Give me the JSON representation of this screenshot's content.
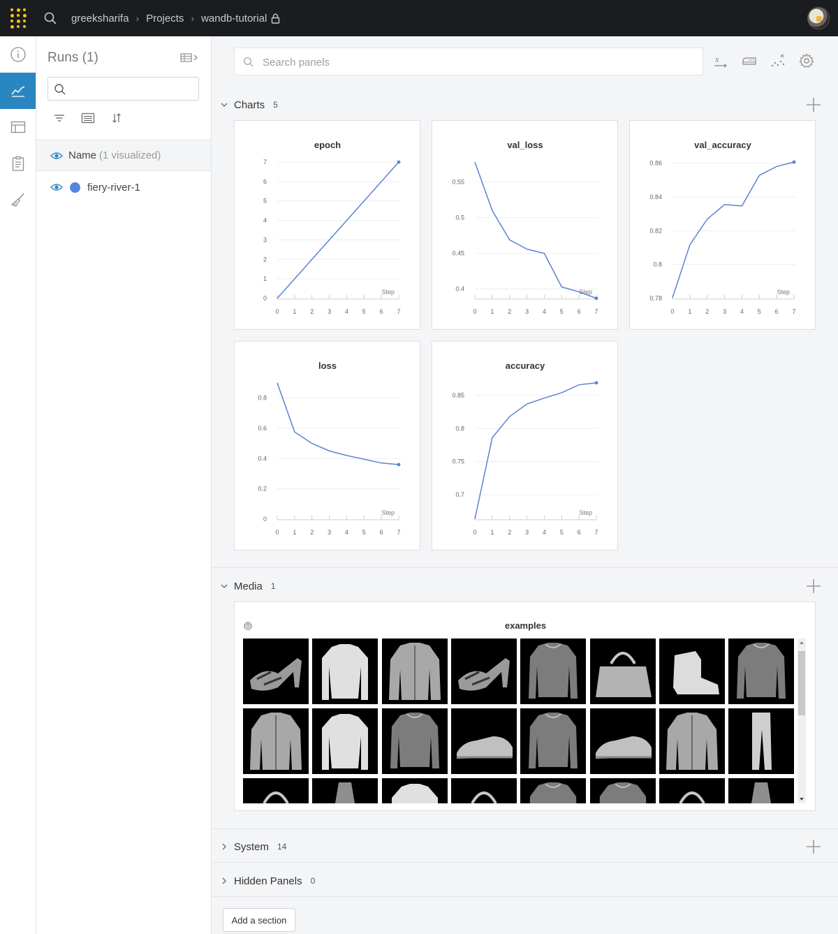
{
  "breadcrumb": {
    "user": "greeksharifa",
    "projects": "Projects",
    "project": "wandb-tutorial"
  },
  "runs": {
    "title": "Runs (1)",
    "header_label": "Name",
    "header_sub": "(1 visualized)",
    "items": [
      {
        "name": "fiery-river-1",
        "color": "#5387dd"
      }
    ]
  },
  "search": {
    "placeholder": "Search panels"
  },
  "sections": {
    "charts": {
      "name": "Charts",
      "count": "5"
    },
    "media": {
      "name": "Media",
      "count": "1"
    },
    "system": {
      "name": "System",
      "count": "14"
    },
    "hidden": {
      "name": "Hidden Panels",
      "count": "0"
    }
  },
  "media": {
    "title": "examples",
    "images": [
      "sandal",
      "shirt",
      "coat",
      "sandal",
      "pullover",
      "bag",
      "ankle-boot",
      "pullover",
      "coat",
      "shirt",
      "pullover",
      "sneaker",
      "pullover",
      "sneaker",
      "coat",
      "trouser",
      "bag",
      "dress",
      "shirt",
      "bag",
      "pullover",
      "pullover",
      "bag",
      "dress"
    ]
  },
  "add_section_label": "Add a section",
  "accent_color": "#2a86c0",
  "line_color": "#5a82d4",
  "chart_data": [
    {
      "type": "line",
      "title": "epoch",
      "xlabel": "Step",
      "ylabel": "",
      "x": [
        0,
        1,
        2,
        3,
        4,
        5,
        6,
        7
      ],
      "y": [
        0,
        1,
        2,
        3,
        4,
        5,
        6,
        7
      ],
      "xlim": [
        0,
        7
      ],
      "ylim": [
        0,
        7
      ],
      "yticks": [
        "0",
        "1",
        "2",
        "3",
        "4",
        "5",
        "6",
        "7"
      ]
    },
    {
      "type": "line",
      "title": "val_loss",
      "xlabel": "Step",
      "ylabel": "",
      "x": [
        0,
        1,
        2,
        3,
        4,
        5,
        6,
        7
      ],
      "y": [
        0.578,
        0.51,
        0.469,
        0.456,
        0.45,
        0.403,
        0.396,
        0.387
      ],
      "xlim": [
        0,
        7
      ],
      "ylim": [
        0.387,
        0.578
      ],
      "yticks": [
        "0.4",
        "0.45",
        "0.5",
        "0.55"
      ]
    },
    {
      "type": "line",
      "title": "val_accuracy",
      "xlabel": "Step",
      "ylabel": "",
      "x": [
        0,
        1,
        2,
        3,
        4,
        5,
        6,
        7
      ],
      "y": [
        0.7803,
        0.8117,
        0.8269,
        0.8355,
        0.8347,
        0.8528,
        0.8581,
        0.8607
      ],
      "xlim": [
        0,
        7
      ],
      "ylim": [
        0.78,
        0.8607
      ],
      "yticks": [
        "0.78",
        "0.8",
        "0.82",
        "0.84",
        "0.86"
      ]
    },
    {
      "type": "line",
      "title": "loss",
      "xlabel": "Step",
      "ylabel": "",
      "x": [
        0,
        1,
        2,
        3,
        4,
        5,
        6,
        7
      ],
      "y": [
        0.9,
        0.575,
        0.5,
        0.45,
        0.42,
        0.395,
        0.37,
        0.36
      ],
      "xlim": [
        0,
        7
      ],
      "ylim": [
        0,
        0.9
      ],
      "yticks": [
        "0",
        "0.2",
        "0.4",
        "0.6",
        "0.8"
      ]
    },
    {
      "type": "line",
      "title": "accuracy",
      "xlabel": "Step",
      "ylabel": "",
      "x": [
        0,
        1,
        2,
        3,
        4,
        5,
        6,
        7
      ],
      "y": [
        0.663,
        0.786,
        0.818,
        0.837,
        0.846,
        0.854,
        0.866,
        0.869
      ],
      "xlim": [
        0,
        7
      ],
      "ylim": [
        0.663,
        0.869
      ],
      "yticks": [
        "0.7",
        "0.75",
        "0.8",
        "0.85"
      ]
    }
  ]
}
